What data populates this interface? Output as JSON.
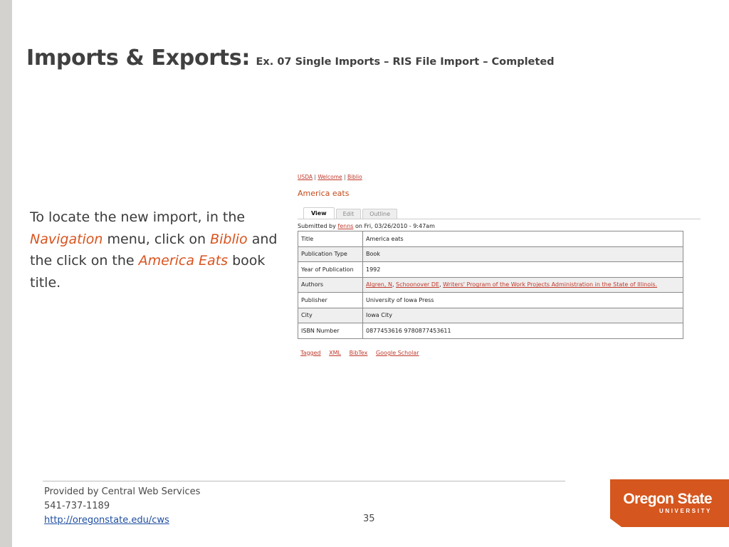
{
  "slide": {
    "title_main": "Imports & Exports:",
    "title_sub": "Ex. 07 Single Imports – RIS File Import – Completed",
    "instruction": {
      "part1": "To locate the new import, in the ",
      "nav": "Navigation",
      "part2": " menu, click on ",
      "biblio": "Biblio",
      "part3": " and the click on the ",
      "book": "America Eats",
      "part4": " book title."
    }
  },
  "screenshot": {
    "breadcrumb": [
      "USDA",
      "Welcome",
      "Biblio"
    ],
    "breadcrumb_sep": " | ",
    "node_title": "America eats",
    "tabs": [
      {
        "label": "View",
        "active": true
      },
      {
        "label": "Edit",
        "active": false
      },
      {
        "label": "Outline",
        "active": false
      }
    ],
    "submitted": {
      "prefix": "Submitted by ",
      "user": "fenns",
      "suffix": " on Fri, 03/26/2010 - 9:47am"
    },
    "table": {
      "title": {
        "label": "Title",
        "value": "America eats"
      },
      "pub_type": {
        "label": "Publication Type",
        "value": "Book"
      },
      "year": {
        "label": "Year of Publication",
        "value": "1992"
      },
      "authors": {
        "label": "Authors",
        "a1": "Algren, N",
        "a2": "Schoonover DE",
        "a3": "Writers' Program of the Work Projects Administration in the State of Illinois.",
        "sep": ", "
      },
      "publisher": {
        "label": "Publisher",
        "value": "University of Iowa Press"
      },
      "city": {
        "label": "City",
        "value": "Iowa City"
      },
      "isbn": {
        "label": "ISBN Number",
        "value": "0877453616 9780877453611"
      }
    },
    "export_links": [
      "Tagged",
      "XML",
      "BibTex",
      "Google Scholar"
    ]
  },
  "footer": {
    "line1": "Provided by Central Web Services",
    "line2": "541-737-1189",
    "url": "http://oregonstate.edu/cws",
    "page_number": "35"
  },
  "logo": {
    "name": "Oregon State",
    "sub": "UNIVERSITY"
  },
  "colors": {
    "accent": "#d9531e",
    "logo_orange": "#d5561e",
    "link_red": "#c0392b",
    "footer_link": "#1f4ea0",
    "left_bar": "#d4d2cf"
  }
}
